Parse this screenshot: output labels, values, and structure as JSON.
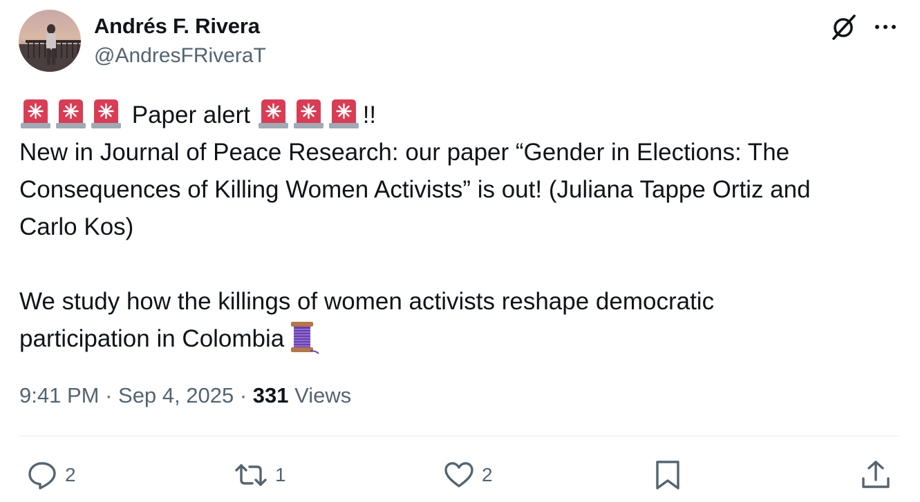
{
  "author": {
    "display_name": "Andrés F. Rivera",
    "handle": "@AndresFRiveraT",
    "avatar_icon": "profile-photo"
  },
  "header_icons": {
    "grok": "grok-icon",
    "more": "more-icon"
  },
  "post": {
    "line1_text": "Paper alert",
    "line1_suffix": "!!",
    "line2": "New in Journal of Peace Research: our paper “Gender in Elections: The",
    "line3": "Consequences of Killing Women Activists” is out! (Juliana Tappe Ortiz and",
    "line4": "Carlo Kos)",
    "line5": "We study how the killings of women activists reshape democratic",
    "line6": "participation in Colombia",
    "emoji_siren": "police-car-light",
    "emoji_thread": "thread-spool"
  },
  "meta": {
    "time": "9:41 PM",
    "sep1": " · ",
    "date": "Sep 4, 2025",
    "sep2": " · ",
    "views_count": "331",
    "views_label": " Views"
  },
  "actions": {
    "replies": "2",
    "reposts": "1",
    "likes": "2"
  },
  "colors": {
    "text": "#0f1419",
    "secondary": "#536471",
    "divider": "#e6ecf0",
    "siren_red": "#d83d55"
  }
}
